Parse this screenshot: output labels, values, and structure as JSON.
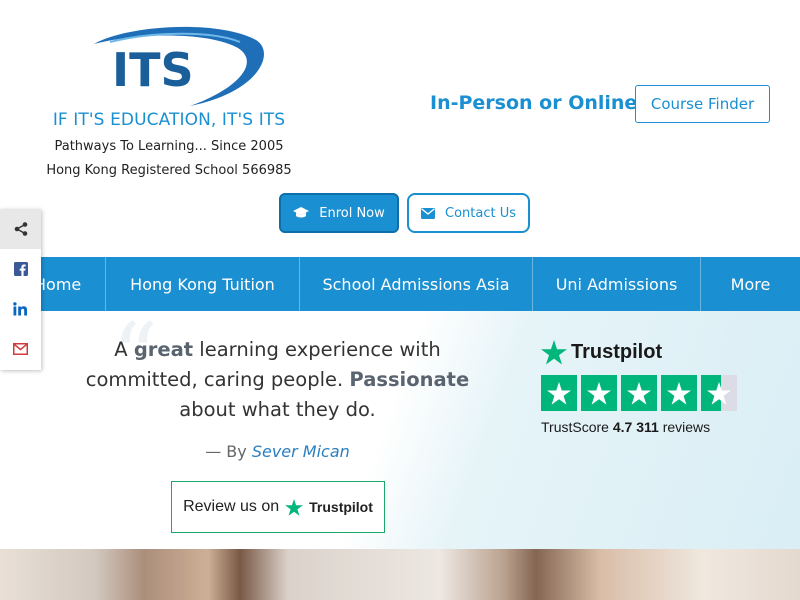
{
  "brand": {
    "logo_text": "ITS",
    "tagline": "IF IT'S EDUCATION, IT'S ITS",
    "subtitle": "Pathways To Learning... Since 2005",
    "registration": "Hong Kong Registered School 566985"
  },
  "header": {
    "headline": "In-Person or Online",
    "course_finder_label": "Course Finder",
    "enrol_label": "Enrol Now",
    "contact_label": "Contact Us"
  },
  "nav": {
    "items": [
      {
        "label": "Home"
      },
      {
        "label": "Hong Kong Tuition"
      },
      {
        "label": "School Admissions Asia"
      },
      {
        "label": "Uni Admissions"
      },
      {
        "label": "More"
      }
    ]
  },
  "share": {
    "icons": [
      "share-icon",
      "facebook-icon",
      "linkedin-icon",
      "email-icon"
    ]
  },
  "review": {
    "quote_part1": "A ",
    "quote_hl1": "great",
    "quote_part2": " learning experience with committed, caring people. ",
    "quote_hl2": "Passionate",
    "quote_part3": " about what they do.",
    "by_prefix": "— By ",
    "author": "Sever Mican",
    "review_button_prefix": "Review us on",
    "review_button_brand": "Trustpilot"
  },
  "trustpilot": {
    "brand": "Trustpilot",
    "trustscore_label": "TrustScore",
    "score": "4.7",
    "reviews_count": "311",
    "reviews_label": "reviews",
    "rating": 4.7,
    "stars_total": 5,
    "color": "#00b67a"
  },
  "colors": {
    "accent": "#1a8fd1",
    "trustpilot_green": "#00b67a"
  }
}
